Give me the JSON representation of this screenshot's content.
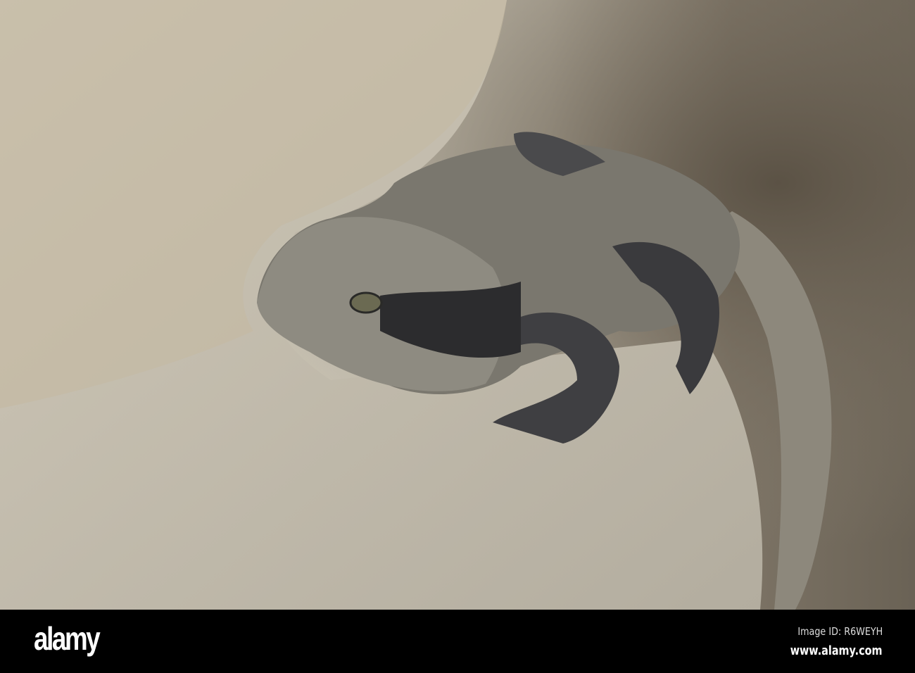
{
  "photo": {
    "subject": "lizard-on-rock"
  },
  "watermark": {
    "logo": "alamy",
    "image_id": "Image ID: R6WEYH",
    "url": "www.alamy.com"
  }
}
